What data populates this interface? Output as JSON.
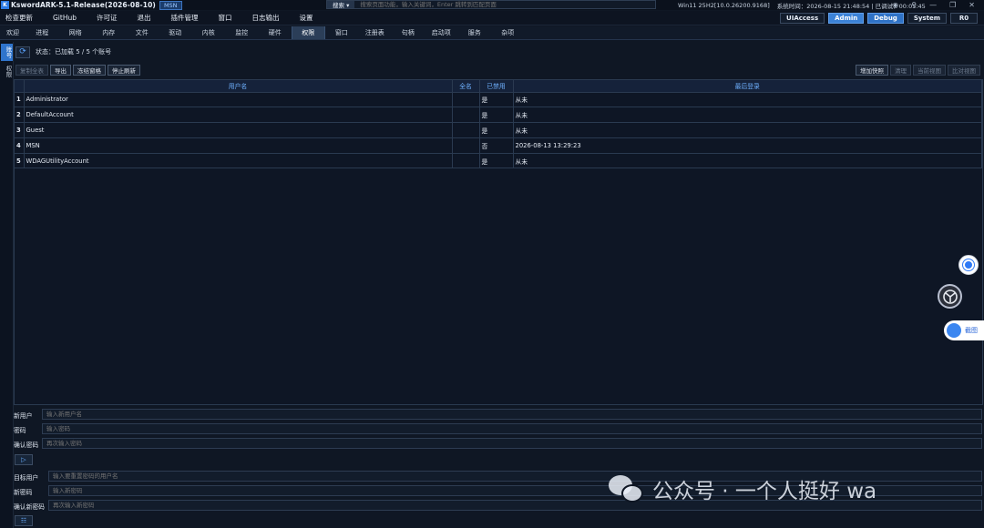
{
  "titlebar": {
    "app_title": "KswordARK-5.1-Release(2026-08-10)",
    "badge": "MSN",
    "search_scope": "搜索 ▾",
    "search_placeholder": "搜索页面功能，输入关键词，Enter 跳转到匹配页面",
    "os_info": "Win11 25H2[10.0.26200.9168]",
    "sys_time": "系统时间：2026-08-15 21:48:54 | 已调试：00:05:45"
  },
  "menu": {
    "items": [
      "检查更新",
      "GitHub",
      "许可证",
      "退出",
      "插件管理",
      "窗口",
      "日志输出",
      "设置"
    ],
    "modes": [
      "UIAccess",
      "Admin",
      "Debug",
      "System",
      "R0"
    ]
  },
  "tabs": {
    "items": [
      "欢迎",
      "进程",
      "网络",
      "内存",
      "文件",
      "驱动",
      "内核",
      "监控",
      "硬件",
      "权限",
      "窗口",
      "注册表",
      "句柄",
      "启动项",
      "服务",
      "杂项"
    ],
    "active": "权限"
  },
  "sidebar": {
    "items": [
      "账号",
      "权限"
    ]
  },
  "status": {
    "text": "状态：已加载 5 / 5 个账号"
  },
  "toolbar": {
    "left": [
      "复制全表",
      "导出",
      "冻结窗格",
      "停止刷新"
    ],
    "right": [
      "增加快照",
      "清理",
      "当前视图",
      "比对视图"
    ]
  },
  "table": {
    "headers": [
      "",
      "用户名",
      "全名",
      "已禁用",
      "最后登录"
    ],
    "rows": [
      {
        "idx": "1",
        "name": "Administrator",
        "full": "",
        "disabled": "是",
        "last": "从未"
      },
      {
        "idx": "2",
        "name": "DefaultAccount",
        "full": "",
        "disabled": "是",
        "last": "从未"
      },
      {
        "idx": "3",
        "name": "Guest",
        "full": "",
        "disabled": "是",
        "last": "从未"
      },
      {
        "idx": "4",
        "name": "MSN",
        "full": "",
        "disabled": "否",
        "last": "2026-08-13 13:29:23"
      },
      {
        "idx": "5",
        "name": "WDAGUtilityAccount",
        "full": "",
        "disabled": "是",
        "last": "从未"
      }
    ]
  },
  "forms": {
    "new_user_label": "新用户",
    "new_user_placeholder": "输入新用户名",
    "password_label": "密码",
    "password_placeholder": "输入密码",
    "confirm_label": "确认密码",
    "confirm_placeholder": "再次输入密码",
    "target_label": "目标用户",
    "target_placeholder": "输入要重置密码的用户名",
    "new_password_label": "新密码",
    "new_password_placeholder": "输入新密码",
    "confirm_new_label": "确认新密码",
    "confirm_new_placeholder": "再次输入新密码"
  },
  "floating": {
    "side_label": "截图"
  },
  "watermark": {
    "text": "公众号 · 一个人挺好 wa"
  }
}
